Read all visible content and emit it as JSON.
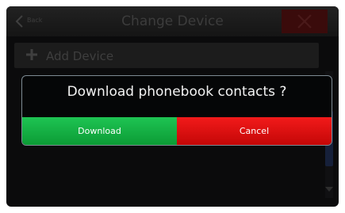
{
  "header": {
    "back_label": "Back",
    "title": "Change Device"
  },
  "list": {
    "add_device_label": "Add Device"
  },
  "dialog": {
    "message": "Download phonebook contacts ?",
    "download_label": "Download",
    "cancel_label": "Cancel"
  },
  "colors": {
    "download": "#11b040",
    "cancel": "#e10f0f",
    "background": "#0b0b0c"
  },
  "icons": {
    "back": "chevron-left-icon",
    "close": "close-icon",
    "add": "plus-icon",
    "scroll_down": "triangle-down-icon"
  }
}
